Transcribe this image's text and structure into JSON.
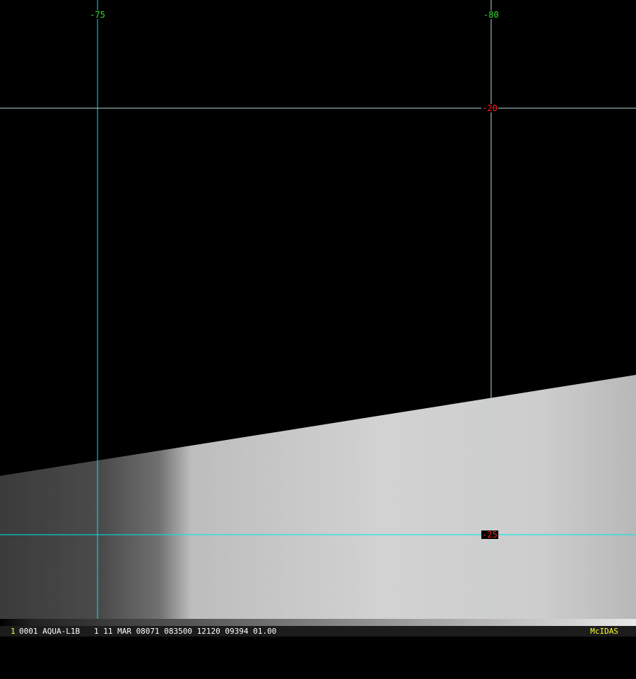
{
  "grid": {
    "longitudes": [
      {
        "label": "-75"
      },
      {
        "label": "-80"
      }
    ],
    "latitudes": [
      {
        "label": "-20"
      },
      {
        "label": "-25"
      }
    ],
    "line_color": "#00e5ee",
    "lon_label_color": "#30e030",
    "lat_label_color": "#ff2020"
  },
  "status_bar": {
    "frame_number": "1",
    "info": "0001 AQUA-L1B   1 11 MAR 08071 083500 12120 09394 01.00",
    "brand": "McIDAS"
  }
}
